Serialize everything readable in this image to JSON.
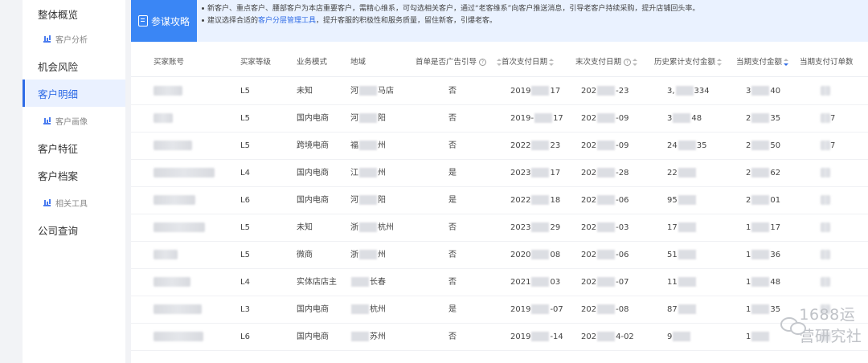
{
  "sidebar": {
    "items": [
      {
        "label": "整体概览",
        "type": "main"
      },
      {
        "label": "客户分析",
        "type": "sub"
      },
      {
        "label": "机会风险",
        "type": "main"
      },
      {
        "label": "客户明细",
        "type": "main",
        "active": true
      },
      {
        "label": "客户画像",
        "type": "sub"
      },
      {
        "label": "客户特征",
        "type": "main"
      },
      {
        "label": "客户档案",
        "type": "main"
      },
      {
        "label": "相关工具",
        "type": "sub"
      },
      {
        "label": "公司查询",
        "type": "main"
      }
    ]
  },
  "tip": {
    "badge_label": "参谋攻略",
    "line1": "新客户、重点客户、腰部客户为本店重要客户，需精心维系，可勾选相关客户，通过“老客维系”向客户推送消息，引导老客户持续采购，提升店铺回头率。",
    "line2_prefix": "建议选择合适的",
    "line2_link": "客户分层管理工具",
    "line2_suffix": "，提升客服的积极性和服务质量，留住新客，引爆老客。"
  },
  "table": {
    "columns": [
      "买家账号",
      "买家等级",
      "业务模式",
      "地域",
      "首单是否广告引导",
      "首次支付日期",
      "末次支付日期",
      "历史累计支付金额",
      "当期支付金额",
      "当期支付订单数"
    ],
    "rows": [
      {
        "level": "L5",
        "mode": "未知",
        "region_a": "河",
        "region_b": "马店",
        "ad": "否",
        "first_a": "2019",
        "first_b": "17",
        "last_a": "202",
        "last_b": "-23",
        "hist_a": "3,",
        "hist_b": "334",
        "cur_a": "3",
        "cur_b": "40"
      },
      {
        "level": "L5",
        "mode": "国内电商",
        "region_a": "河",
        "region_b": "阳",
        "ad": "否",
        "first_a": "2019-",
        "first_b": "17",
        "last_a": "202",
        "last_b": "-09",
        "hist_a": "3",
        "hist_b": "48",
        "cur_a": "2",
        "cur_b": "35",
        "cnt": "7"
      },
      {
        "level": "L5",
        "mode": "跨境电商",
        "region_a": "福",
        "region_b": "州",
        "ad": "否",
        "first_a": "2022",
        "first_b": "23",
        "last_a": "202",
        "last_b": "-09",
        "hist_a": "24",
        "hist_b": "35",
        "cur_a": "2",
        "cur_b": "50",
        "cnt": "7"
      },
      {
        "level": "L4",
        "mode": "国内电商",
        "region_a": "江",
        "region_b": "州",
        "ad": "是",
        "first_a": "2023",
        "first_b": "17",
        "last_a": "202",
        "last_b": "-28",
        "hist_a": "22",
        "hist_b": "",
        "cur_a": "2",
        "cur_b": "62"
      },
      {
        "level": "L6",
        "mode": "国内电商",
        "region_a": "河",
        "region_b": "阳",
        "ad": "是",
        "first_a": "2022",
        "first_b": "18",
        "last_a": "202",
        "last_b": "-06",
        "hist_a": "95",
        "hist_b": "",
        "cur_a": "2",
        "cur_b": "01"
      },
      {
        "level": "L5",
        "mode": "未知",
        "region_a": "浙",
        "region_b": "杭州",
        "ad": "否",
        "first_a": "2023",
        "first_b": "29",
        "last_a": "202",
        "last_b": "-03",
        "hist_a": "17",
        "hist_b": "",
        "cur_a": "1",
        "cur_b": "17"
      },
      {
        "level": "L5",
        "mode": "微商",
        "region_a": "浙",
        "region_b": "州",
        "ad": "否",
        "first_a": "2020",
        "first_b": "08",
        "last_a": "202",
        "last_b": "-06",
        "hist_a": "51",
        "hist_b": "",
        "cur_a": "1",
        "cur_b": "36"
      },
      {
        "level": "L4",
        "mode": "实体店店主",
        "region_a": "",
        "region_b": "长春",
        "ad": "否",
        "first_a": "2021",
        "first_b": "03",
        "last_a": "202",
        "last_b": "-07",
        "hist_a": "11",
        "hist_b": "",
        "cur_a": "1",
        "cur_b": "48"
      },
      {
        "level": "L3",
        "mode": "国内电商",
        "region_a": "",
        "region_b": "杭州",
        "ad": "是",
        "first_a": "2019",
        "first_b": "-07",
        "last_a": "202",
        "last_b": "-08",
        "hist_a": "87",
        "hist_b": "",
        "cur_a": "1",
        "cur_b": "35"
      },
      {
        "level": "L6",
        "mode": "国内电商",
        "region_a": "",
        "region_b": "苏州",
        "ad": "否",
        "first_a": "2019",
        "first_b": "-14",
        "last_a": "202",
        "last_b": "4-02",
        "hist_a": "9",
        "hist_b": "",
        "cur_a": "1",
        "cur_b": ""
      }
    ]
  },
  "watermark": {
    "text": "1688运营研究社",
    "icon": "wechat-icon"
  },
  "colors": {
    "accent": "#2e6be6",
    "badge": "#3a86f5",
    "banner": "#eaf2ff",
    "active_bg": "#eaf1ff"
  }
}
